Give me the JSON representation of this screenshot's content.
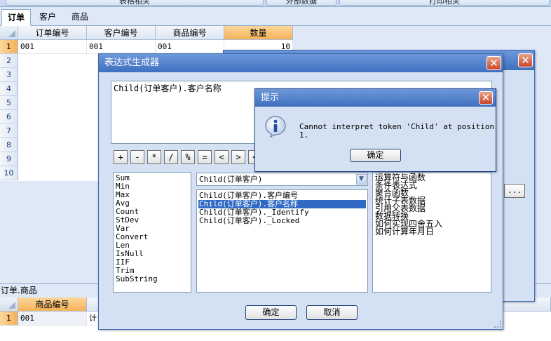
{
  "toolbar": {
    "buttons": [
      "表格相关",
      "外部数据",
      "打印相关"
    ]
  },
  "tabs": [
    {
      "label": "订单",
      "active": true
    },
    {
      "label": "客户",
      "active": false
    },
    {
      "label": "商品",
      "active": false
    }
  ],
  "grid": {
    "columns": [
      "订单编号",
      "客户编号",
      "商品编号",
      "数量"
    ],
    "rows": [
      {
        "num": "1",
        "cells": [
          "001",
          "001",
          "001",
          "10"
        ]
      },
      {
        "num": "2"
      },
      {
        "num": "3"
      },
      {
        "num": "4"
      },
      {
        "num": "5"
      },
      {
        "num": "6"
      },
      {
        "num": "7"
      },
      {
        "num": "8"
      },
      {
        "num": "9"
      },
      {
        "num": "10"
      }
    ]
  },
  "bottom": {
    "label": "订单.商品",
    "columns": [
      "商品编号"
    ],
    "row": {
      "num": "1",
      "cells": [
        "001",
        "计"
      ]
    }
  },
  "backwin": {
    "ellipsis_label": "..."
  },
  "expr_dialog": {
    "title": "表达式生成器",
    "expression": "Child(订单客户).客户名称",
    "operators": [
      "+",
      "-",
      "*",
      "/",
      "%",
      "=",
      "<",
      ">",
      "<"
    ],
    "functions": [
      "Sum",
      "Min",
      "Max",
      "Avg",
      "Count",
      "StDev",
      "Var",
      "Convert",
      "Len",
      "IsNull",
      "IIF",
      "Trim",
      "SubString"
    ],
    "field_select": "Child(订单客户)",
    "fields": [
      "Child(订单客户).客户编号",
      "Child(订单客户).客户名称",
      "Child(订单客户)._Identify",
      "Child(订单客户)._Locked"
    ],
    "selected_field_index": 1,
    "help_topics": [
      "运算符与函数",
      "条件表达式",
      "聚合函数",
      "统计子表数据",
      "引用父表数据",
      "数据转换",
      "如何实现四舍五入",
      "如何计算年月日"
    ],
    "ok_label": "确定",
    "cancel_label": "取消"
  },
  "alert": {
    "title": "提示",
    "message": "Cannot interpret token 'Child' at position 1.",
    "ok_label": "确定",
    "icon": "info-icon"
  },
  "colors": {
    "title_bar": "#3f6fc0",
    "selection": "#316ac5",
    "header_selected": "#f5b25a"
  }
}
